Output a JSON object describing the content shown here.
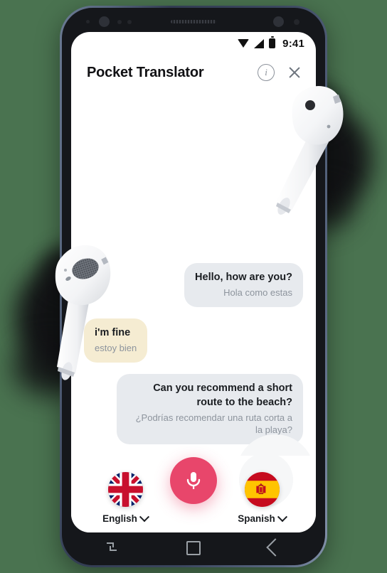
{
  "background_color": "#4a7350",
  "device": {
    "name": "android-smartphone",
    "frame_color": "#56647d",
    "nav_bar": {
      "recents_label": "recents",
      "home_label": "home",
      "back_label": "back"
    }
  },
  "status_bar": {
    "time": "9:41",
    "icons": [
      "wifi-icon",
      "signal-icon",
      "battery-icon"
    ]
  },
  "header": {
    "title": "Pocket Translator",
    "info_label": "i",
    "info_icon": "info-circle-icon",
    "close_icon": "close-icon"
  },
  "chat": {
    "messages": [
      {
        "id": "msg-1",
        "side": "right",
        "style": "gray",
        "primary": "Hello, how are you?",
        "secondary": "Hola como estas"
      },
      {
        "id": "msg-2",
        "side": "left",
        "style": "yellow",
        "primary": "i'm fine",
        "secondary": "estoy bien"
      },
      {
        "id": "msg-3",
        "side": "right",
        "style": "gray",
        "primary": "Can you recommend a short route to the beach?",
        "secondary": "¿Podrías recomendar una ruta corta a la playa?"
      }
    ]
  },
  "controls": {
    "source_language": {
      "label": "English",
      "flag": "union-jack-flag-icon"
    },
    "target_language": {
      "label": "Spanish",
      "flag": "spain-flag-icon"
    },
    "mic": {
      "icon": "microphone-icon",
      "color": "#e8466b"
    }
  },
  "decorations": {
    "airpod_right": "airpod-earbud-right",
    "airpod_left": "airpod-earbud-left"
  }
}
